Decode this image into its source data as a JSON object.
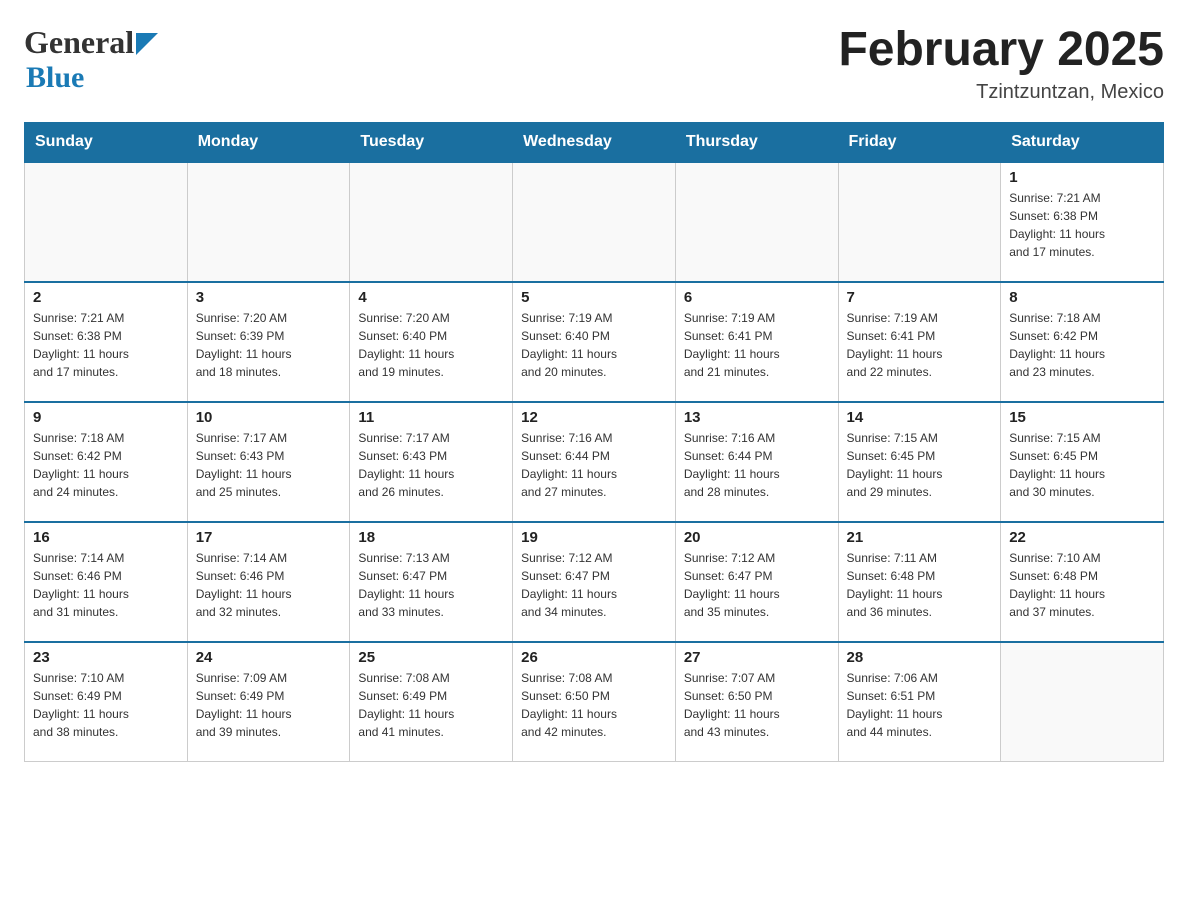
{
  "header": {
    "logo_general": "General",
    "logo_blue": "Blue",
    "month_title": "February 2025",
    "location": "Tzintzuntzan, Mexico"
  },
  "days_of_week": [
    "Sunday",
    "Monday",
    "Tuesday",
    "Wednesday",
    "Thursday",
    "Friday",
    "Saturday"
  ],
  "weeks": [
    {
      "days": [
        {
          "num": "",
          "info": ""
        },
        {
          "num": "",
          "info": ""
        },
        {
          "num": "",
          "info": ""
        },
        {
          "num": "",
          "info": ""
        },
        {
          "num": "",
          "info": ""
        },
        {
          "num": "",
          "info": ""
        },
        {
          "num": "1",
          "info": "Sunrise: 7:21 AM\nSunset: 6:38 PM\nDaylight: 11 hours\nand 17 minutes."
        }
      ]
    },
    {
      "days": [
        {
          "num": "2",
          "info": "Sunrise: 7:21 AM\nSunset: 6:38 PM\nDaylight: 11 hours\nand 17 minutes."
        },
        {
          "num": "3",
          "info": "Sunrise: 7:20 AM\nSunset: 6:39 PM\nDaylight: 11 hours\nand 18 minutes."
        },
        {
          "num": "4",
          "info": "Sunrise: 7:20 AM\nSunset: 6:40 PM\nDaylight: 11 hours\nand 19 minutes."
        },
        {
          "num": "5",
          "info": "Sunrise: 7:19 AM\nSunset: 6:40 PM\nDaylight: 11 hours\nand 20 minutes."
        },
        {
          "num": "6",
          "info": "Sunrise: 7:19 AM\nSunset: 6:41 PM\nDaylight: 11 hours\nand 21 minutes."
        },
        {
          "num": "7",
          "info": "Sunrise: 7:19 AM\nSunset: 6:41 PM\nDaylight: 11 hours\nand 22 minutes."
        },
        {
          "num": "8",
          "info": "Sunrise: 7:18 AM\nSunset: 6:42 PM\nDaylight: 11 hours\nand 23 minutes."
        }
      ]
    },
    {
      "days": [
        {
          "num": "9",
          "info": "Sunrise: 7:18 AM\nSunset: 6:42 PM\nDaylight: 11 hours\nand 24 minutes."
        },
        {
          "num": "10",
          "info": "Sunrise: 7:17 AM\nSunset: 6:43 PM\nDaylight: 11 hours\nand 25 minutes."
        },
        {
          "num": "11",
          "info": "Sunrise: 7:17 AM\nSunset: 6:43 PM\nDaylight: 11 hours\nand 26 minutes."
        },
        {
          "num": "12",
          "info": "Sunrise: 7:16 AM\nSunset: 6:44 PM\nDaylight: 11 hours\nand 27 minutes."
        },
        {
          "num": "13",
          "info": "Sunrise: 7:16 AM\nSunset: 6:44 PM\nDaylight: 11 hours\nand 28 minutes."
        },
        {
          "num": "14",
          "info": "Sunrise: 7:15 AM\nSunset: 6:45 PM\nDaylight: 11 hours\nand 29 minutes."
        },
        {
          "num": "15",
          "info": "Sunrise: 7:15 AM\nSunset: 6:45 PM\nDaylight: 11 hours\nand 30 minutes."
        }
      ]
    },
    {
      "days": [
        {
          "num": "16",
          "info": "Sunrise: 7:14 AM\nSunset: 6:46 PM\nDaylight: 11 hours\nand 31 minutes."
        },
        {
          "num": "17",
          "info": "Sunrise: 7:14 AM\nSunset: 6:46 PM\nDaylight: 11 hours\nand 32 minutes."
        },
        {
          "num": "18",
          "info": "Sunrise: 7:13 AM\nSunset: 6:47 PM\nDaylight: 11 hours\nand 33 minutes."
        },
        {
          "num": "19",
          "info": "Sunrise: 7:12 AM\nSunset: 6:47 PM\nDaylight: 11 hours\nand 34 minutes."
        },
        {
          "num": "20",
          "info": "Sunrise: 7:12 AM\nSunset: 6:47 PM\nDaylight: 11 hours\nand 35 minutes."
        },
        {
          "num": "21",
          "info": "Sunrise: 7:11 AM\nSunset: 6:48 PM\nDaylight: 11 hours\nand 36 minutes."
        },
        {
          "num": "22",
          "info": "Sunrise: 7:10 AM\nSunset: 6:48 PM\nDaylight: 11 hours\nand 37 minutes."
        }
      ]
    },
    {
      "days": [
        {
          "num": "23",
          "info": "Sunrise: 7:10 AM\nSunset: 6:49 PM\nDaylight: 11 hours\nand 38 minutes."
        },
        {
          "num": "24",
          "info": "Sunrise: 7:09 AM\nSunset: 6:49 PM\nDaylight: 11 hours\nand 39 minutes."
        },
        {
          "num": "25",
          "info": "Sunrise: 7:08 AM\nSunset: 6:49 PM\nDaylight: 11 hours\nand 41 minutes."
        },
        {
          "num": "26",
          "info": "Sunrise: 7:08 AM\nSunset: 6:50 PM\nDaylight: 11 hours\nand 42 minutes."
        },
        {
          "num": "27",
          "info": "Sunrise: 7:07 AM\nSunset: 6:50 PM\nDaylight: 11 hours\nand 43 minutes."
        },
        {
          "num": "28",
          "info": "Sunrise: 7:06 AM\nSunset: 6:51 PM\nDaylight: 11 hours\nand 44 minutes."
        },
        {
          "num": "",
          "info": ""
        }
      ]
    }
  ]
}
